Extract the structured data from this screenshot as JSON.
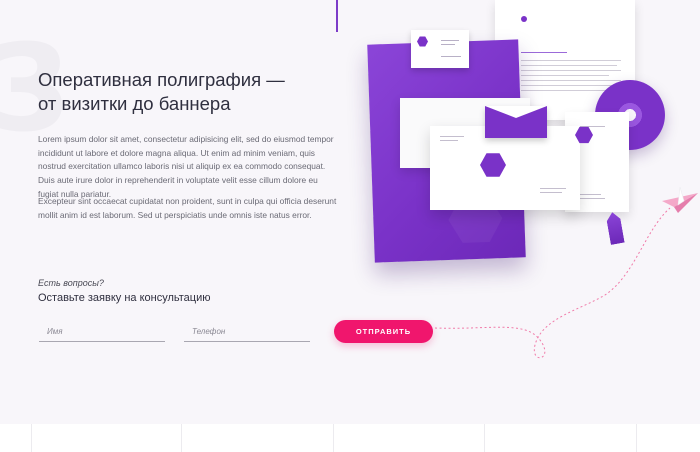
{
  "hero": {
    "title_line1": "Оперативная полиграфия —",
    "title_line2": "от визитки до баннера",
    "paragraph1": "Lorem ipsum dolor sit amet, consectetur adipisicing elit, sed do eiusmod tempor incididunt ut labore et dolore magna aliqua. Ut enim ad minim veniam, quis nostrud exercitation ullamco laboris nisi ut aliquip ex ea commodo consequat. Duis aute irure dolor in reprehenderit in voluptate velit esse cillum dolore eu fugiat nulla pariatur.",
    "paragraph2": "Excepteur sint occaecat cupidatat non proident, sunt in culpa qui officia deserunt mollit anim id est laborum. Sed ut perspiciatis unde omnis iste natus error."
  },
  "contact_form": {
    "question": "Есть вопросы?",
    "heading": "Оставьте заявку на консультацию",
    "name_placeholder": "Имя",
    "phone_placeholder": "Телефон",
    "submit_label": "ОТПРАВИТЬ"
  },
  "colors": {
    "accent_purple": "#7a32c8",
    "button_pink": "#f0166d",
    "background": "#f8f6fa"
  },
  "icons": {
    "paper_plane": "paper-plane-icon"
  }
}
